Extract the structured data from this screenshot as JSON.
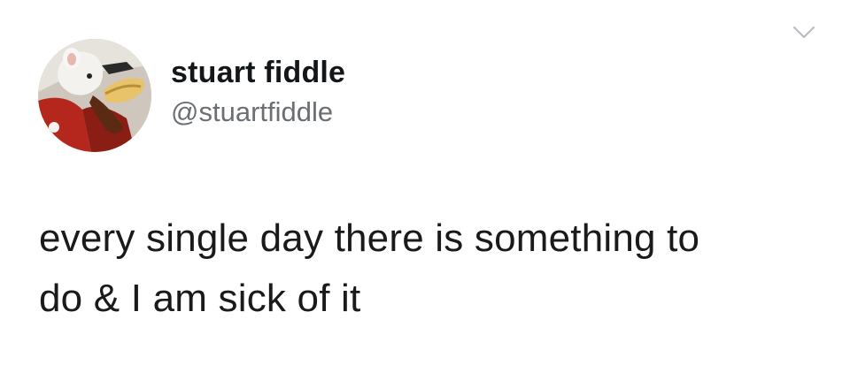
{
  "tweet": {
    "author": {
      "display_name": "stuart fiddle",
      "handle": "@stuartfiddle",
      "avatar_icon": "stuart-little-avatar"
    },
    "menu_icon": "chevron-down-icon",
    "text_lines": [
      "every single day there is something to",
      "do & I am sick of it"
    ]
  },
  "colors": {
    "background": "#ffffff",
    "name": "#14171a",
    "handle": "#6b6f73",
    "body_text": "#1a1a1a",
    "chevron": "#b8bcc0"
  }
}
